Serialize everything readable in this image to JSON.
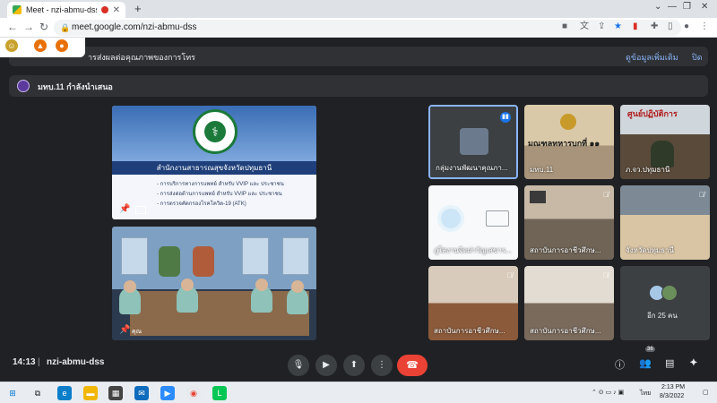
{
  "browser": {
    "tab_title": "Meet - nzi-abmu-dss",
    "url": "meet.google.com/nzi-abmu-dss",
    "new_tab": "+"
  },
  "banner": {
    "text": "ารส่งผลต่อคุณภาพของการโทร",
    "more": "ดูข้อมูลเพิ่มเติม",
    "close": "ปิด"
  },
  "presenter": {
    "text": "มทบ.11 กำลังนำเสนอ"
  },
  "slide": {
    "header": "สำนักงานสาธารณสุขจังหวัดปทุมธานี",
    "bullets": [
      "- การบริการทางการแพทย์ สำหรับ VVIP และ ประชาชน",
      "- การส่งต่อด้านการแพทย์ สำหรับ VVIP และ ประชาชน",
      "- การตรวจคัดกรองโรคโควิด-19 (ATK)"
    ]
  },
  "room_tile": {
    "name": "คุณ"
  },
  "participants": [
    {
      "label": "กลุ่มงานพัฒนาคุณภา...",
      "speaking": true
    },
    {
      "label": "มทบ.11",
      "screen_text": "มณฑลทหารบกที่ ๑๑"
    },
    {
      "label": "ภ.จว.ปทุมธานี",
      "screen_text": "ศูนย์ปฏิบัติการ"
    },
    {
      "label": "ภู่ใสงานจิตผ่าวัญเสขาร..."
    },
    {
      "label": "สถาบันการอาชีวศึกษ..."
    },
    {
      "label": "จังหวัดปทุมธานี"
    },
    {
      "label": "สถาบันการอาชีวศึกษ..."
    },
    {
      "label": "สถาบันการอาชีวศึกษ..."
    }
  ],
  "more_tile": {
    "label": "อีก 25 คน"
  },
  "bottom_bar": {
    "time": "14:13",
    "separator": "|",
    "meeting_code": "nzi-abmu-dss",
    "people_count": "36"
  },
  "taskbar": {
    "time": "2:13 PM",
    "date": "8/3/2022",
    "lang": "ไทย"
  },
  "colors": {
    "meet_bg": "#202124",
    "leave_red": "#ea4335",
    "accent_blue": "#1a73e8"
  }
}
